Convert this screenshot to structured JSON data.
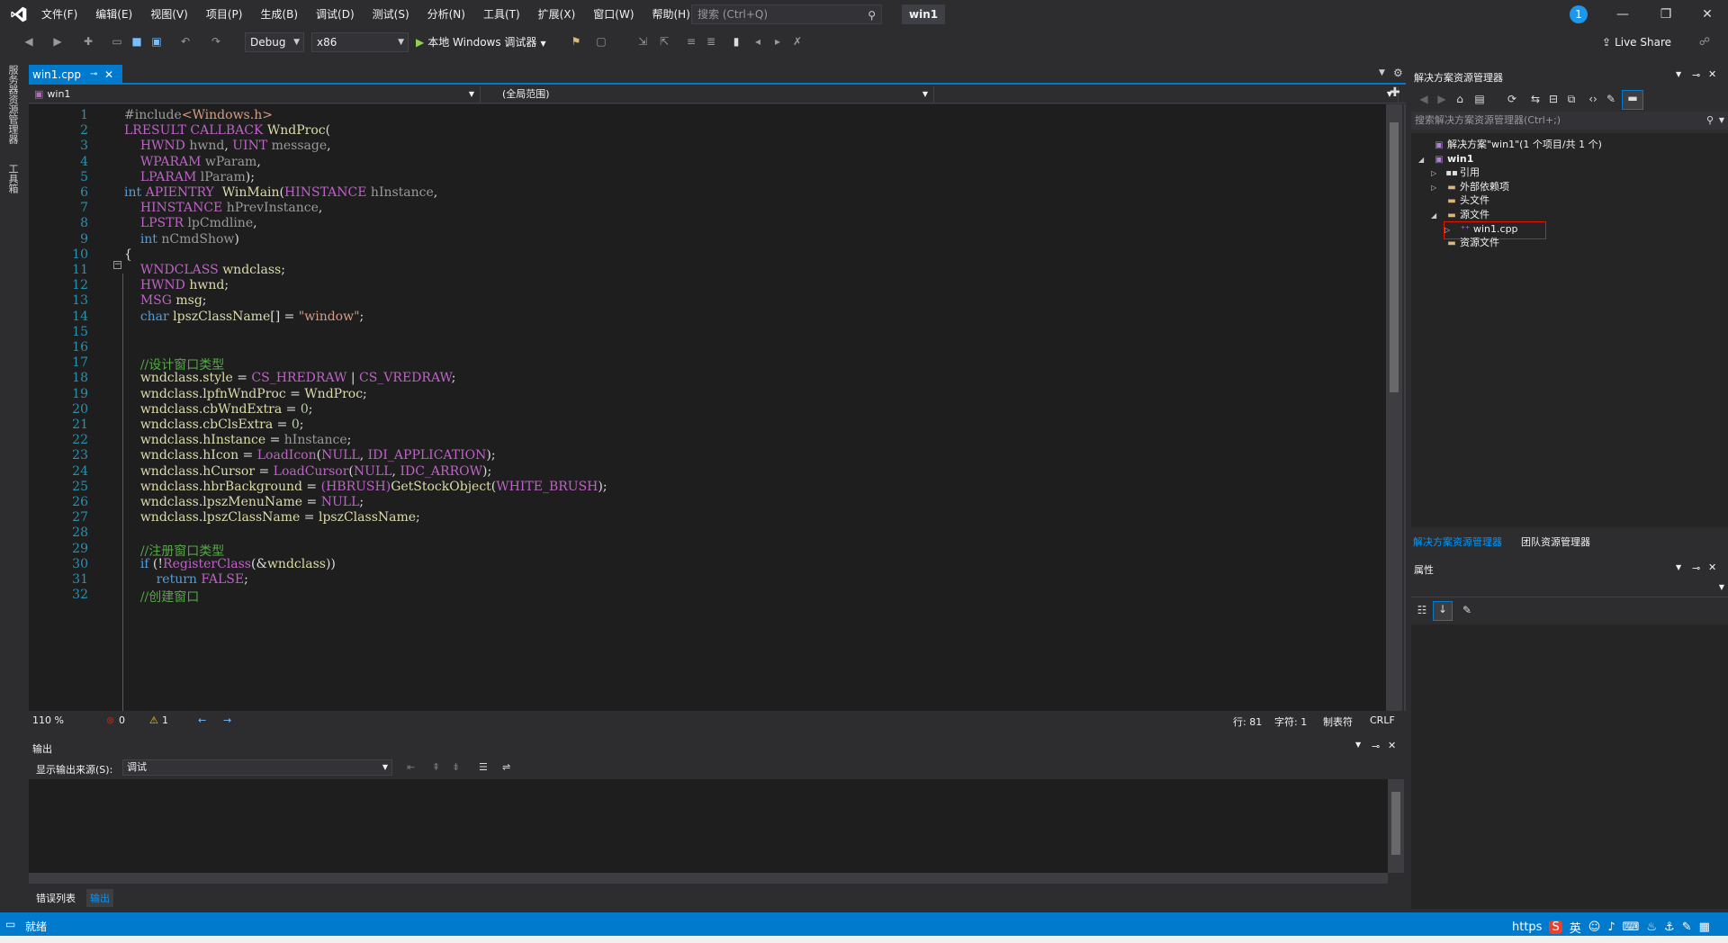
{
  "menu": [
    "文件(F)",
    "编辑(E)",
    "视图(V)",
    "项目(P)",
    "生成(B)",
    "调试(D)",
    "测试(S)",
    "分析(N)",
    "工具(T)",
    "扩展(X)",
    "窗口(W)",
    "帮助(H)"
  ],
  "search": {
    "placeholder": "搜索 (Ctrl+Q)"
  },
  "solution_title": "win1",
  "notifications": "1",
  "toolbar": {
    "config": "Debug",
    "platform": "x86",
    "run_label": "本地 Windows 调试器",
    "live_share": "Live Share"
  },
  "left_strip": {
    "server_explorer": "服务器资源管理器",
    "toolbox": "工具箱"
  },
  "editor": {
    "tab": "win1.cpp",
    "nav_file": "win1",
    "nav_scope": "(全局范围)",
    "lines": [
      [
        {
          "t": "#include",
          "c": "inc"
        },
        {
          "t": "<Windows.h>",
          "c": "incname"
        }
      ],
      [
        {
          "t": "LRESULT",
          "c": "mac"
        },
        {
          "t": " "
        },
        {
          "t": "CALLBACK",
          "c": "mac"
        },
        {
          "t": " "
        },
        {
          "t": "WndProc",
          "c": "fn"
        },
        {
          "t": "("
        }
      ],
      [
        {
          "t": "    "
        },
        {
          "t": "HWND",
          "c": "mac"
        },
        {
          "t": " "
        },
        {
          "t": "hwnd",
          "c": "par"
        },
        {
          "t": ", "
        },
        {
          "t": "UINT",
          "c": "mac"
        },
        {
          "t": " "
        },
        {
          "t": "message",
          "c": "par"
        },
        {
          "t": ","
        }
      ],
      [
        {
          "t": "    "
        },
        {
          "t": "WPARAM",
          "c": "mac"
        },
        {
          "t": " "
        },
        {
          "t": "wParam",
          "c": "par"
        },
        {
          "t": ","
        }
      ],
      [
        {
          "t": "    "
        },
        {
          "t": "LPARAM",
          "c": "mac"
        },
        {
          "t": " "
        },
        {
          "t": "lParam",
          "c": "par"
        },
        {
          "t": ");"
        }
      ],
      [
        {
          "t": "int",
          "c": "kw"
        },
        {
          "t": " "
        },
        {
          "t": "APIENTRY",
          "c": "mac"
        },
        {
          "t": "  "
        },
        {
          "t": "WinMain",
          "c": "fn"
        },
        {
          "t": "("
        },
        {
          "t": "HINSTANCE",
          "c": "mac"
        },
        {
          "t": " "
        },
        {
          "t": "hInstance",
          "c": "par"
        },
        {
          "t": ","
        }
      ],
      [
        {
          "t": "    "
        },
        {
          "t": "HINSTANCE",
          "c": "mac"
        },
        {
          "t": " "
        },
        {
          "t": "hPrevInstance",
          "c": "par"
        },
        {
          "t": ","
        }
      ],
      [
        {
          "t": "    "
        },
        {
          "t": "LPSTR",
          "c": "mac"
        },
        {
          "t": " "
        },
        {
          "t": "lpCmdline",
          "c": "par"
        },
        {
          "t": ","
        }
      ],
      [
        {
          "t": "    "
        },
        {
          "t": "int",
          "c": "kw"
        },
        {
          "t": " "
        },
        {
          "t": "nCmdShow",
          "c": "par"
        },
        {
          "t": ")"
        }
      ],
      [
        {
          "t": "{"
        }
      ],
      [
        {
          "t": "    "
        },
        {
          "t": "WNDCLASS",
          "c": "mac"
        },
        {
          "t": " "
        },
        {
          "t": "wndclass",
          "c": "fn"
        },
        {
          "t": ";"
        }
      ],
      [
        {
          "t": "    "
        },
        {
          "t": "HWND",
          "c": "mac"
        },
        {
          "t": " "
        },
        {
          "t": "hwnd",
          "c": "fn"
        },
        {
          "t": ";"
        }
      ],
      [
        {
          "t": "    "
        },
        {
          "t": "MSG",
          "c": "mac"
        },
        {
          "t": " "
        },
        {
          "t": "msg",
          "c": "fn"
        },
        {
          "t": ";"
        }
      ],
      [
        {
          "t": "    "
        },
        {
          "t": "char",
          "c": "kw"
        },
        {
          "t": " "
        },
        {
          "t": "lpszClassName",
          "c": "fn"
        },
        {
          "t": "[] = "
        },
        {
          "t": "\"window\"",
          "c": "str"
        },
        {
          "t": ";"
        }
      ],
      [],
      [],
      [
        {
          "t": "    "
        },
        {
          "t": "//设计窗口类型",
          "c": "cm"
        }
      ],
      [
        {
          "t": "    "
        },
        {
          "t": "wndclass",
          "c": "fn"
        },
        {
          "t": "."
        },
        {
          "t": "style",
          "c": "fn"
        },
        {
          "t": " = "
        },
        {
          "t": "CS_HREDRAW",
          "c": "mac"
        },
        {
          "t": " | "
        },
        {
          "t": "CS_VREDRAW",
          "c": "mac"
        },
        {
          "t": ";"
        }
      ],
      [
        {
          "t": "    "
        },
        {
          "t": "wndclass",
          "c": "fn"
        },
        {
          "t": "."
        },
        {
          "t": "lpfnWndProc",
          "c": "fn"
        },
        {
          "t": " = "
        },
        {
          "t": "WndProc",
          "c": "fn"
        },
        {
          "t": ";"
        }
      ],
      [
        {
          "t": "    "
        },
        {
          "t": "wndclass",
          "c": "fn"
        },
        {
          "t": "."
        },
        {
          "t": "cbWndExtra",
          "c": "fn"
        },
        {
          "t": " = "
        },
        {
          "t": "0",
          "c": "num"
        },
        {
          "t": ";"
        }
      ],
      [
        {
          "t": "    "
        },
        {
          "t": "wndclass",
          "c": "fn"
        },
        {
          "t": "."
        },
        {
          "t": "cbClsExtra",
          "c": "fn"
        },
        {
          "t": " = "
        },
        {
          "t": "0",
          "c": "num"
        },
        {
          "t": ";"
        }
      ],
      [
        {
          "t": "    "
        },
        {
          "t": "wndclass",
          "c": "fn"
        },
        {
          "t": "."
        },
        {
          "t": "hInstance",
          "c": "fn"
        },
        {
          "t": " = "
        },
        {
          "t": "hInstance",
          "c": "par"
        },
        {
          "t": ";"
        }
      ],
      [
        {
          "t": "    "
        },
        {
          "t": "wndclass",
          "c": "fn"
        },
        {
          "t": "."
        },
        {
          "t": "hIcon",
          "c": "fn"
        },
        {
          "t": " = "
        },
        {
          "t": "LoadIcon",
          "c": "mac"
        },
        {
          "t": "("
        },
        {
          "t": "NULL",
          "c": "mac"
        },
        {
          "t": ", "
        },
        {
          "t": "IDI_APPLICATION",
          "c": "mac"
        },
        {
          "t": ");"
        }
      ],
      [
        {
          "t": "    "
        },
        {
          "t": "wndclass",
          "c": "fn"
        },
        {
          "t": "."
        },
        {
          "t": "hCursor",
          "c": "fn"
        },
        {
          "t": " = "
        },
        {
          "t": "LoadCursor",
          "c": "mac"
        },
        {
          "t": "("
        },
        {
          "t": "NULL",
          "c": "mac"
        },
        {
          "t": ", "
        },
        {
          "t": "IDC_ARROW",
          "c": "mac"
        },
        {
          "t": ");"
        }
      ],
      [
        {
          "t": "    "
        },
        {
          "t": "wndclass",
          "c": "fn"
        },
        {
          "t": "."
        },
        {
          "t": "hbrBackground",
          "c": "fn"
        },
        {
          "t": " = "
        },
        {
          "t": "(HBRUSH)",
          "c": "mac"
        },
        {
          "t": "GetStockObject",
          "c": "fn"
        },
        {
          "t": "("
        },
        {
          "t": "WHITE_BRUSH",
          "c": "mac"
        },
        {
          "t": ");"
        }
      ],
      [
        {
          "t": "    "
        },
        {
          "t": "wndclass",
          "c": "fn"
        },
        {
          "t": "."
        },
        {
          "t": "lpszMenuName",
          "c": "fn"
        },
        {
          "t": " = "
        },
        {
          "t": "NULL",
          "c": "mac"
        },
        {
          "t": ";"
        }
      ],
      [
        {
          "t": "    "
        },
        {
          "t": "wndclass",
          "c": "fn"
        },
        {
          "t": "."
        },
        {
          "t": "lpszClassName",
          "c": "fn"
        },
        {
          "t": " = "
        },
        {
          "t": "lpszClassName",
          "c": "fn"
        },
        {
          "t": ";"
        }
      ],
      [],
      [
        {
          "t": "    "
        },
        {
          "t": "//注册窗口类型",
          "c": "cm"
        }
      ],
      [
        {
          "t": "    "
        },
        {
          "t": "if",
          "c": "kw"
        },
        {
          "t": " (!"
        },
        {
          "t": "RegisterClass",
          "c": "mac"
        },
        {
          "t": "(&"
        },
        {
          "t": "wndclass",
          "c": "fn"
        },
        {
          "t": "))"
        }
      ],
      [
        {
          "t": "        "
        },
        {
          "t": "return",
          "c": "kw"
        },
        {
          "t": " "
        },
        {
          "t": "FALSE",
          "c": "mac"
        },
        {
          "t": ";"
        }
      ],
      [
        {
          "t": "    "
        },
        {
          "t": "//创建窗口",
          "c": "cm"
        }
      ]
    ]
  },
  "editor_status": {
    "zoom": "110 %",
    "errors": "0",
    "warnings": "1",
    "line": "行: 81",
    "char": "字符: 1",
    "tabs": "制表符",
    "eol": "CRLF"
  },
  "output": {
    "title": "输出",
    "source_label": "显示输出来源(S):",
    "source_value": "调试",
    "tabs": [
      "错误列表",
      "输出"
    ]
  },
  "solution_explorer": {
    "title": "解决方案资源管理器",
    "search_placeholder": "搜索解决方案资源管理器(Ctrl+;)",
    "tree": [
      {
        "label": "解决方案\"win1\"(1 个项目/共 1 个)",
        "level": 0,
        "arrow": "",
        "icon": "solution-icon",
        "bold": false
      },
      {
        "label": "win1",
        "level": 0,
        "arrow": "◢",
        "icon": "project-icon",
        "bold": true
      },
      {
        "label": "引用",
        "level": 1,
        "arrow": "▷",
        "icon": "references-icon",
        "bold": false
      },
      {
        "label": "外部依赖项",
        "level": 1,
        "arrow": "▷",
        "icon": "folder-icon",
        "bold": false
      },
      {
        "label": "头文件",
        "level": 1,
        "arrow": "",
        "icon": "folder-icon",
        "bold": false
      },
      {
        "label": "源文件",
        "level": 1,
        "arrow": "◢",
        "icon": "folder-icon",
        "bold": false
      },
      {
        "label": "win1.cpp",
        "level": 2,
        "arrow": "▷",
        "icon": "cpp-file-icon",
        "bold": false,
        "highlight": true
      },
      {
        "label": "资源文件",
        "level": 1,
        "arrow": "",
        "icon": "folder-icon",
        "bold": false
      }
    ],
    "bottom_tabs": [
      "解决方案资源管理器",
      "团队资源管理器"
    ]
  },
  "properties": {
    "title": "属性"
  },
  "status_bar": {
    "text": "就绪",
    "url_fragment": "https",
    "ime": "英"
  },
  "colors": {
    "accent": "#007acc",
    "background": "#2d2d30",
    "editor_bg": "#1e1e1e"
  }
}
